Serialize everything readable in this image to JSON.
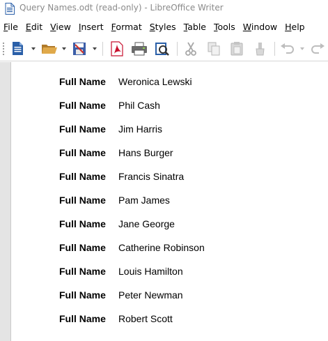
{
  "window": {
    "title": "Query Names.odt (read-only) - LibreOffice Writer",
    "app_icon": "writer-document-icon"
  },
  "menu": [
    {
      "label": "File",
      "accel": "F",
      "rest": "ile"
    },
    {
      "label": "Edit",
      "accel": "E",
      "rest": "dit"
    },
    {
      "label": "View",
      "accel": "V",
      "rest": "iew"
    },
    {
      "label": "Insert",
      "accel": "I",
      "rest": "nsert"
    },
    {
      "label": "Format",
      "accel": "F",
      "rest": "ormat"
    },
    {
      "label": "Styles",
      "accel": "S",
      "rest": "tyles"
    },
    {
      "label": "Table",
      "accel": "T",
      "rest": "able"
    },
    {
      "label": "Tools",
      "accel": "T",
      "rest": "ools"
    },
    {
      "label": "Window",
      "accel": "W",
      "rest": "indow"
    },
    {
      "label": "Help",
      "accel": "H",
      "rest": "elp"
    }
  ],
  "toolbar": {
    "buttons": [
      "new-document-icon",
      "open-folder-icon",
      "save-icon",
      "export-pdf-icon",
      "print-icon",
      "print-preview-icon",
      "cut-icon",
      "copy-icon",
      "paste-icon",
      "clone-formatting-icon",
      "undo-icon",
      "redo-icon"
    ]
  },
  "document": {
    "field_label": "Full Name",
    "names": [
      "Weronica Lewski",
      "Phil Cash",
      "Jim Harris",
      "Hans Burger",
      "Francis Sinatra",
      "Pam James",
      "Jane George",
      "Catherine Robinson",
      "Louis Hamilton",
      "Peter Newman",
      "Robert Scott"
    ]
  },
  "colors": {
    "title_text": "#8a8a8a",
    "margin_gray": "#e4e4e4",
    "pdf_red": "#c8102e",
    "doc_blue": "#2a5fa8"
  }
}
